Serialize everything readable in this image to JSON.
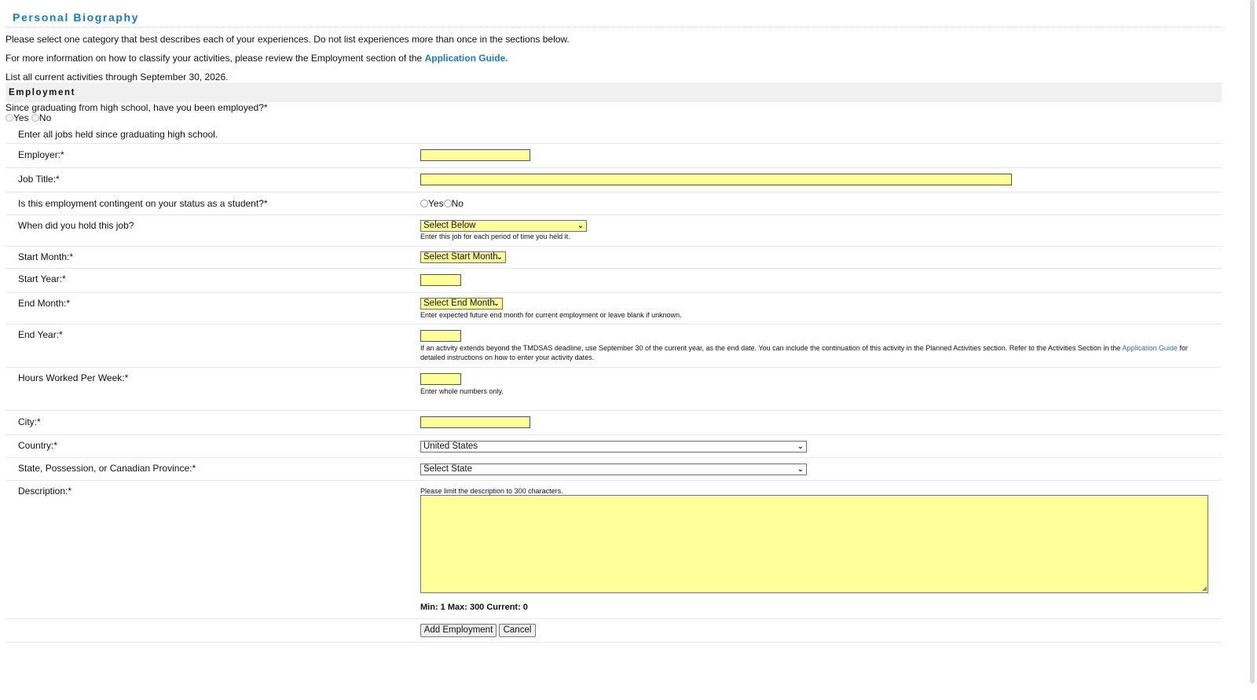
{
  "page": {
    "title": "Personal Biography",
    "intro1": "Please select one category that best describes each of your experiences. Do not list experiences more than once in the sections below.",
    "intro2_pre": "For more information on how to classify your activities, please review the Employment section of the",
    "intro2_link": "Application Guide.",
    "intro3": "List all current activities through September 30, 2026."
  },
  "section": {
    "title": "Employment",
    "employed_question": "Since graduating from high school, have you been employed?*",
    "yes": "Yes",
    "no": "No",
    "enter_all": "Enter all jobs held since graduating high school."
  },
  "form": {
    "employer_label": "Employer:*",
    "job_title_label": "Job Title:*",
    "contingent_label": "Is this employment contingent on your status as a student?*",
    "contingent_yes": "Yes",
    "contingent_no": "No",
    "when_label": "When did you hold this job?",
    "when_value": "Select Below",
    "when_hint": "Enter this job for each period of time you held it.",
    "start_month_label": "Start Month:*",
    "start_month_value": "Select Start Month",
    "start_year_label": "Start Year:*",
    "end_month_label": "End Month:*",
    "end_month_value": "Select End Month",
    "end_month_hint": "Enter expected future end month for current employment or leave blank if unknown.",
    "end_year_label": "End Year:*",
    "end_year_hint_pre": "If an activity extends beyond the TMDSAS deadline, use September 30 of the current year, as the end date. You can include the continuation of this activity in the Planned Activities section. Refer to the Activities Section in the",
    "end_year_hint_link": "Application Guide",
    "end_year_hint_post": "for detailed instructions on how to enter your activity dates.",
    "hours_label": "Hours Worked Per Week:*",
    "hours_hint": "Enter whole numbers only.",
    "city_label": "City:*",
    "country_label": "Country:*",
    "country_value": "United States",
    "state_label": "State, Possession, or Canadian Province:*",
    "state_value": "Select State",
    "description_label": "Description:*",
    "description_hint": "Please limit the description to 300 characters.",
    "counter": "Min: 1 Max: 300 Current: 0",
    "add_button": "Add Employment",
    "cancel_button": "Cancel"
  },
  "colors": {
    "accent": "#1d7ab8",
    "field_fill": "#ffff99",
    "section_bar": "#f0f0f0"
  },
  "icons": {
    "dropdown": "chevron-down-icon",
    "radio": "radio-icon",
    "resize": "resize-grip-icon"
  }
}
